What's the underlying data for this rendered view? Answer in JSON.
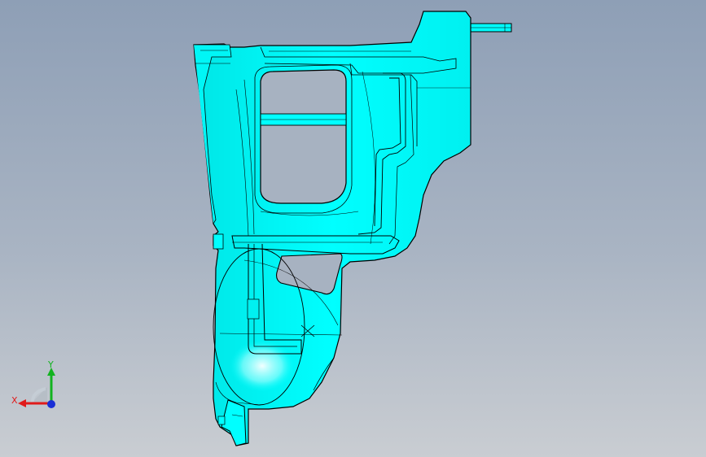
{
  "viewport": {
    "background_top": "#8e9fb6",
    "background_bottom": "#c9cdd2"
  },
  "model": {
    "name": "cyan-part-icon",
    "fill_color": "#00ffff",
    "edge_color": "#000000"
  },
  "triad": {
    "x_label": "X",
    "y_label": "Y",
    "x_color": "#e01b1b",
    "y_color": "#12b31f",
    "z_color": "#1a2fd6"
  }
}
